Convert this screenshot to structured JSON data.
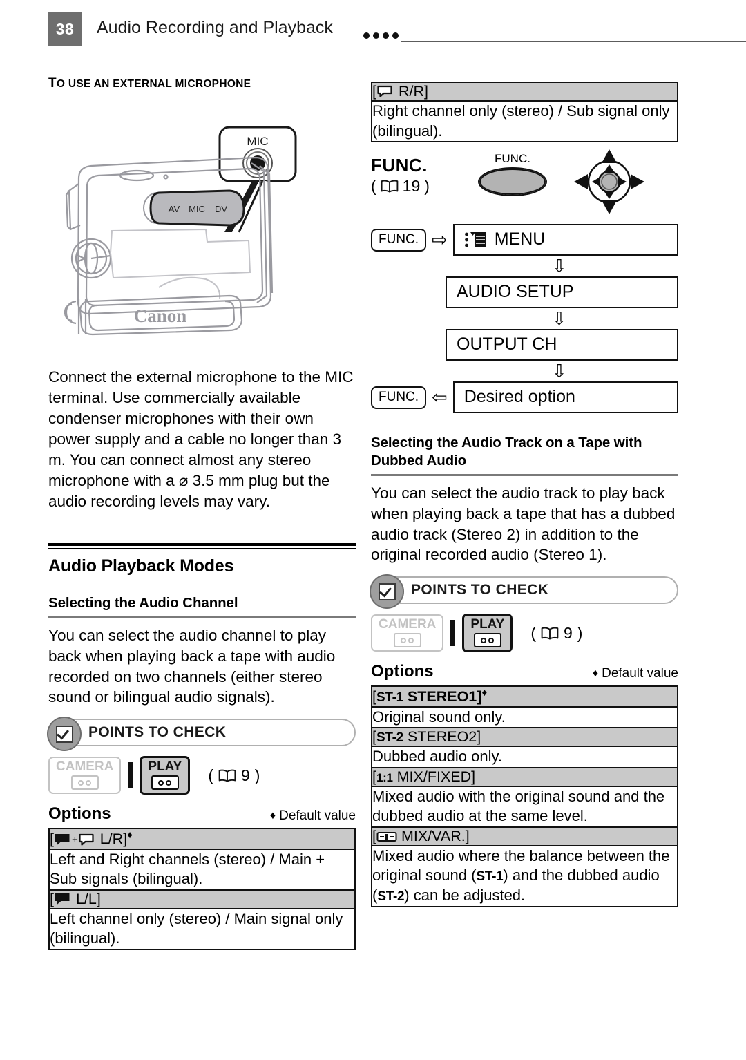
{
  "header": {
    "page_number": "38",
    "title": "Audio Recording and Playback",
    "dot_count": 4
  },
  "left_column": {
    "section_heading": "TO USE AN EXTERNAL MICROPHONE",
    "illustration": {
      "callout_label": "MIC",
      "terminal_labels": [
        "AV",
        "MIC",
        "DV"
      ],
      "brand": "Canon"
    },
    "body_paragraph": "Connect the external microphone to the MIC terminal. Use commercially available condenser microphones with their own power supply and a cable no longer than 3 m. You can connect almost any stereo microphone with a ⌀ 3.5 mm plug but the audio recording levels may vary.",
    "section_title": "Audio Playback Modes",
    "subsection_title": "Selecting the Audio Channel",
    "subsection_body": "You can select the audio channel to play back when playing back a tape with audio recorded on two channels (either stereo sound or bilingual audio signals).",
    "points_to_check": {
      "label": "POINTS TO CHECK",
      "icon": "checkbox-circle-icon",
      "modes": [
        {
          "label": "CAMERA",
          "state": "inactive",
          "icon": "tape-icon"
        },
        {
          "label": "PLAY",
          "state": "active",
          "icon": "tape-icon"
        }
      ],
      "page_ref": "9",
      "page_ref_icon": "book-icon"
    },
    "options": {
      "title": "Options",
      "default_note": "Default value",
      "default_marker": "♦",
      "rows": [
        {
          "key": "[ L/R]",
          "key_icons": [
            "speaker-filled-icon",
            "plus-sign",
            "speaker-outline-icon"
          ],
          "key_text": "L/R",
          "default": true,
          "value": "Left and Right channels (stereo) / Main + Sub signals (bilingual)."
        },
        {
          "key": "[ L/L]",
          "key_icons": [
            "speaker-filled-icon"
          ],
          "key_text": "L/L",
          "default": false,
          "value": "Left channel only (stereo) / Main signal only (bilingual)."
        }
      ]
    }
  },
  "right_column": {
    "continued_option": {
      "key_icons": [
        "speaker-outline-icon"
      ],
      "key_text": "R/R",
      "value": "Right channel only (stereo) / Sub signal only (bilingual)."
    },
    "func_block": {
      "title": "FUNC.",
      "page_ref": "19",
      "page_ref_icon": "book-icon",
      "button_label": "FUNC.",
      "joystick_icon": "joystick-four-way-icon"
    },
    "menu_flow": {
      "step1_key": "FUNC.",
      "step1_arrow": "⇨",
      "step1_label": "MENU",
      "step1_icon": "menu-list-icon",
      "down_arrow": "⇩",
      "step2_label": "AUDIO  SETUP",
      "step3_label": "OUTPUT CH",
      "step4_key": "FUNC.",
      "step4_arrow": "⇦",
      "step4_label": "Desired option"
    },
    "subsection_title": "Selecting the Audio Track on a Tape with Dubbed Audio",
    "subsection_body": "You can select the audio track to play back when playing back a tape that has a dubbed audio track (Stereo 2) in addition to the original recorded audio (Stereo 1).",
    "points_to_check": {
      "label": "POINTS TO CHECK",
      "icon": "checkbox-circle-icon",
      "modes": [
        {
          "label": "CAMERA",
          "state": "inactive",
          "icon": "tape-icon"
        },
        {
          "label": "PLAY",
          "state": "active",
          "icon": "tape-icon"
        }
      ],
      "page_ref": "9",
      "page_ref_icon": "book-icon"
    },
    "options": {
      "title": "Options",
      "default_note": "Default value",
      "default_marker": "♦",
      "rows": [
        {
          "badge": "ST-1",
          "key_text": "STEREO1]",
          "default": true,
          "value": "Original sound only."
        },
        {
          "badge": "ST-2",
          "key_text": "STEREO2]",
          "default": false,
          "value": "Dubbed audio only."
        },
        {
          "badge": "1:1",
          "key_text": "MIX/FIXED]",
          "default": false,
          "value": "Mixed audio with the original sound and the dubbed audio at the same level."
        },
        {
          "badge_icon": "mix-slider-icon",
          "key_text": "MIX/VAR.]",
          "default": false,
          "value_parts": [
            "Mixed audio where the balance between the original sound (",
            "ST-1",
            ") and the dubbed audio (",
            "ST-2",
            ") can be adjusted."
          ]
        }
      ]
    }
  },
  "colors": {
    "page_number_bg": "#6e6e6e",
    "table_header_bg": "#c9c9c9",
    "rule_gray": "#7a7a7a",
    "badge_gray": "#9e9e9e",
    "inactive_gray": "#c3c3c3"
  }
}
